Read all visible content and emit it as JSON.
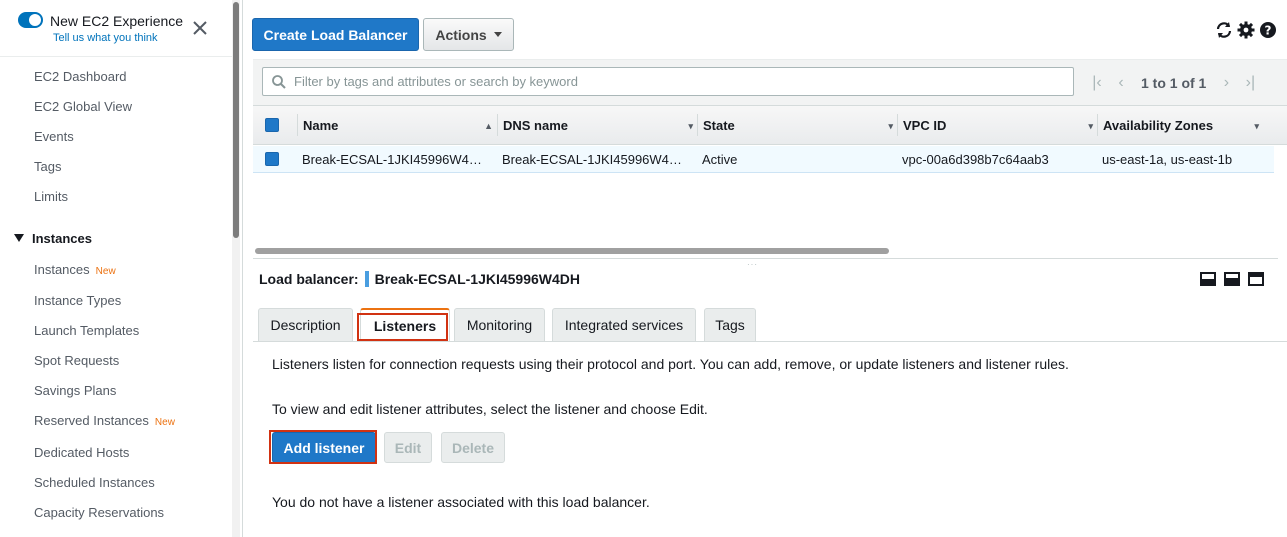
{
  "sidebar": {
    "toggle_label": "New EC2 Experience",
    "feedback_link": "Tell us what you think",
    "top_items": [
      {
        "label": "EC2 Dashboard"
      },
      {
        "label": "EC2 Global View"
      },
      {
        "label": "Events"
      },
      {
        "label": "Tags"
      },
      {
        "label": "Limits"
      }
    ],
    "section_title": "Instances",
    "instance_items": [
      {
        "label": "Instances",
        "badge": "New"
      },
      {
        "label": "Instance Types",
        "badge": ""
      },
      {
        "label": "Launch Templates",
        "badge": ""
      },
      {
        "label": "Spot Requests",
        "badge": ""
      },
      {
        "label": "Savings Plans",
        "badge": ""
      },
      {
        "label": "Reserved Instances",
        "badge": "New"
      },
      {
        "label": "Dedicated Hosts",
        "badge": ""
      },
      {
        "label": "Scheduled Instances",
        "badge": ""
      },
      {
        "label": "Capacity Reservations",
        "badge": ""
      }
    ]
  },
  "toolbar": {
    "create_label": "Create Load Balancer",
    "actions_label": "Actions",
    "icons": [
      "refresh-icon",
      "settings-icon",
      "help-icon"
    ]
  },
  "filter": {
    "placeholder": "Filter by tags and attributes or search by keyword",
    "pager_text": "1 to 1 of 1"
  },
  "table": {
    "columns": [
      {
        "label": "Name",
        "sort": "▲"
      },
      {
        "label": "DNS name",
        "sort": "▾"
      },
      {
        "label": "State",
        "sort": "▾"
      },
      {
        "label": "VPC ID",
        "sort": "▾"
      },
      {
        "label": "Availability Zones",
        "sort": "▾"
      }
    ],
    "rows": [
      {
        "name": "Break-ECSAL-1JKI45996W4…",
        "dns": "Break-ECSAL-1JKI45996W4…",
        "state": "Active",
        "vpc": "vpc-00a6d398b7c64aab3",
        "az": "us-east-1a, us-east-1b"
      }
    ]
  },
  "detail": {
    "label": "Load balancer:",
    "name": "Break-ECSAL-1JKI45996W4DH",
    "tabs": [
      {
        "label": "Description"
      },
      {
        "label": "Listeners"
      },
      {
        "label": "Monitoring"
      },
      {
        "label": "Integrated services"
      },
      {
        "label": "Tags"
      }
    ],
    "active_tab": "Listeners",
    "info_1": "Listeners listen for connection requests using their protocol and port. You can add, remove, or update listeners and listener rules.",
    "info_2": "To view and edit listener attributes, select the listener and choose Edit.",
    "add_label": "Add listener",
    "edit_label": "Edit",
    "delete_label": "Delete",
    "empty_text": "You do not have a listener associated with this load balancer."
  },
  "colors": {
    "primary": "#1f78c8",
    "accent_tab": "#ec7211",
    "highlight": "#d13212",
    "link": "#0073bb"
  }
}
